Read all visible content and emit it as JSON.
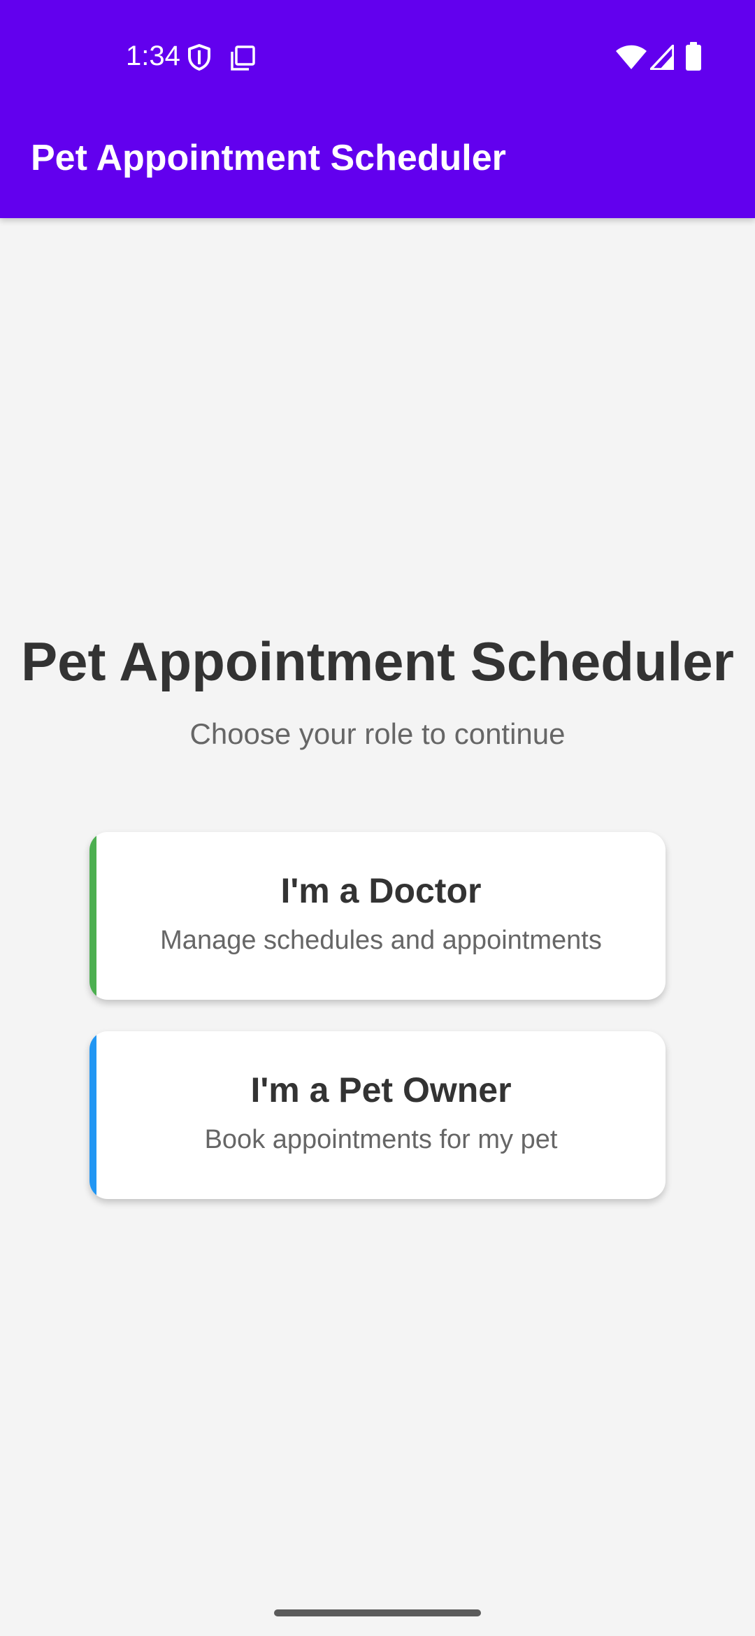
{
  "status_bar": {
    "time": "1:34",
    "icons": [
      "shield-icon",
      "sim-card-icon",
      "wifi-icon",
      "signal-icon",
      "battery-icon"
    ]
  },
  "app_bar": {
    "title": "Pet Appointment Scheduler",
    "color": "#6200ee"
  },
  "main": {
    "heading": "Pet Appointment Scheduler",
    "subtitle": "Choose your role to continue",
    "roles": [
      {
        "title": "I'm a Doctor",
        "description": "Manage schedules and appointments",
        "accent_color": "#4caf50"
      },
      {
        "title": "I'm a Pet Owner",
        "description": "Book appointments for my pet",
        "accent_color": "#2196f3"
      }
    ]
  }
}
